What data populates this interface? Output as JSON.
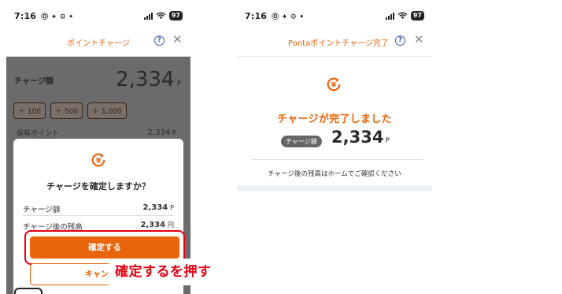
{
  "colors": {
    "accent": "#e8650b",
    "annotation_red": "#e60012",
    "help_blue": "#3a5bb5"
  },
  "left": {
    "status": {
      "time": "7:16",
      "icons": "Ⓞ ✦ ⚙ •",
      "battery": "97"
    },
    "nav_title": "ポイントチャージ",
    "charge_label": "チャージ額",
    "charge_amount": "2,334",
    "unit_p": "P",
    "chips": [
      "＋ 100",
      "＋ 500",
      "＋ 1,000"
    ],
    "holdings_label": "保有ポイント",
    "holdings_value": "2,334",
    "modal": {
      "title": "チャージを確定しますか？",
      "row1_label": "チャージ額",
      "row1_value": "2,334",
      "row1_unit": "P",
      "row2_label": "チャージ後の残高",
      "row2_value": "2,334",
      "row2_unit": "円",
      "confirm_label": "確定する",
      "cancel_label": "キャンセル"
    },
    "annotation": "確定するを押す"
  },
  "right": {
    "status": {
      "time": "7:16",
      "icons": "Ⓞ ✦ ⚙ •",
      "battery": "97"
    },
    "nav_title": "Pontaポイントチャージ完了",
    "done_title": "チャージが完了しました",
    "badge": "チャージ額",
    "amount": "2,334",
    "unit_p": "P",
    "note": "チャージ後の残高はホームでご確認ください"
  },
  "icons": {
    "help": "help-icon",
    "close": "close-icon",
    "yen": "yen-refresh-icon"
  }
}
